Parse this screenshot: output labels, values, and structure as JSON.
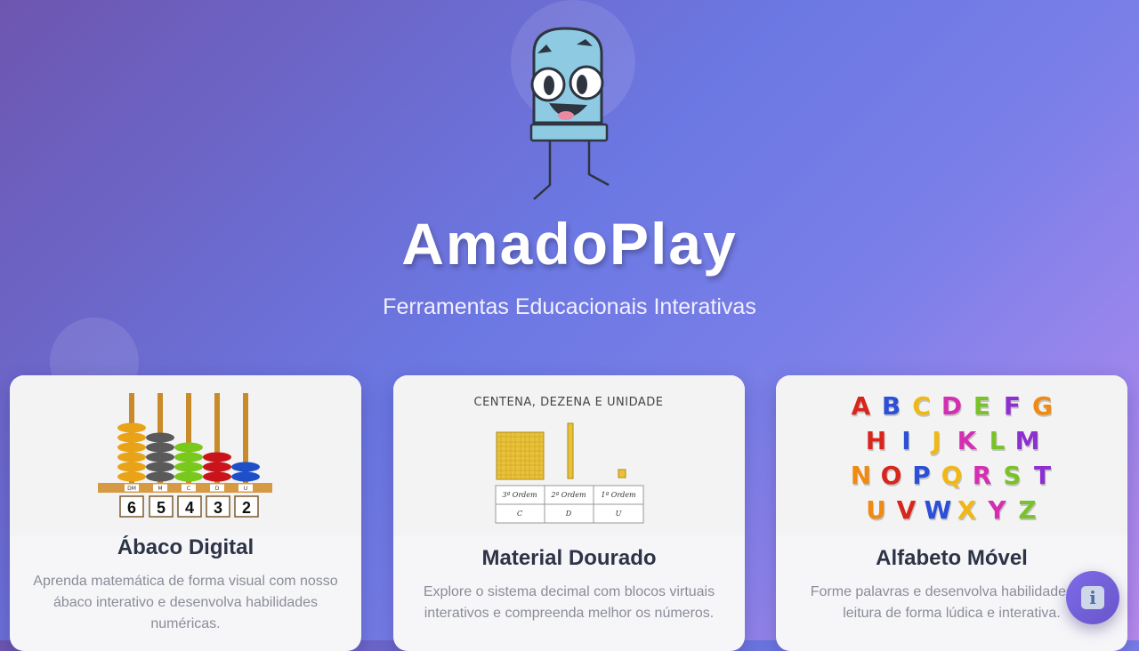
{
  "app": {
    "title": "AmadoPlay",
    "subtitle": "Ferramentas Educacionais Interativas"
  },
  "cards": [
    {
      "title": "Ábaco Digital",
      "description": "Aprenda matemática de forma visual com nosso ábaco interativo e desenvolva habilidades numéricas.",
      "image": {
        "place_labels": [
          "DM",
          "M",
          "C",
          "D",
          "U"
        ],
        "digits": [
          "6",
          "5",
          "4",
          "3",
          "2"
        ]
      }
    },
    {
      "title": "Material Dourado",
      "description": "Explore o sistema decimal com blocos virtuais interativos e compreenda melhor os números.",
      "image": {
        "heading": "CENTENA, DEZENA E UNIDADE",
        "orders": [
          "3ª Ordem",
          "2ª Ordem",
          "1ª Ordem"
        ],
        "letters": [
          "C",
          "D",
          "U"
        ]
      }
    },
    {
      "title": "Alfabeto Móvel",
      "description": "Forme palavras e desenvolva habilidades de leitura de forma lúdica e interativa.",
      "image": {
        "rows": [
          "ABCDEFG",
          "HIJKLM",
          "NOPQRST",
          "UVWXYZ"
        ]
      }
    }
  ],
  "info_button": {
    "icon": "info-icon"
  }
}
